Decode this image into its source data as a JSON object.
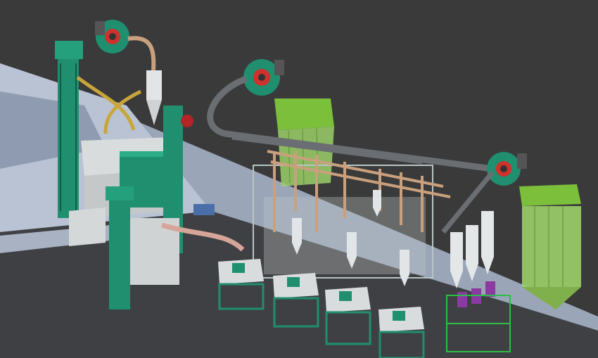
{
  "scene": {
    "kind": "3d-render",
    "subject": "flour-milling-plant",
    "colors": {
      "background": "#3a3a3a",
      "floor": "#b4bccb",
      "machine_green": "#1f8f6f",
      "machine_light": "#d9dcdc",
      "pipe_grey": "#6a6e72",
      "pipe_tan": "#c9a07d",
      "dust_filter_green": "#7bbf3a",
      "bag_purple": "#8a3aa0",
      "fan_accent": "#d0312d"
    },
    "components": [
      "bucket-elevator",
      "cleaning-section",
      "exhaust-fan",
      "cyclone",
      "roller-mill",
      "plansifter-frame",
      "pneumatic-pipe",
      "pulse-dust-filter",
      "bagging-cyclone",
      "support-frame"
    ]
  }
}
